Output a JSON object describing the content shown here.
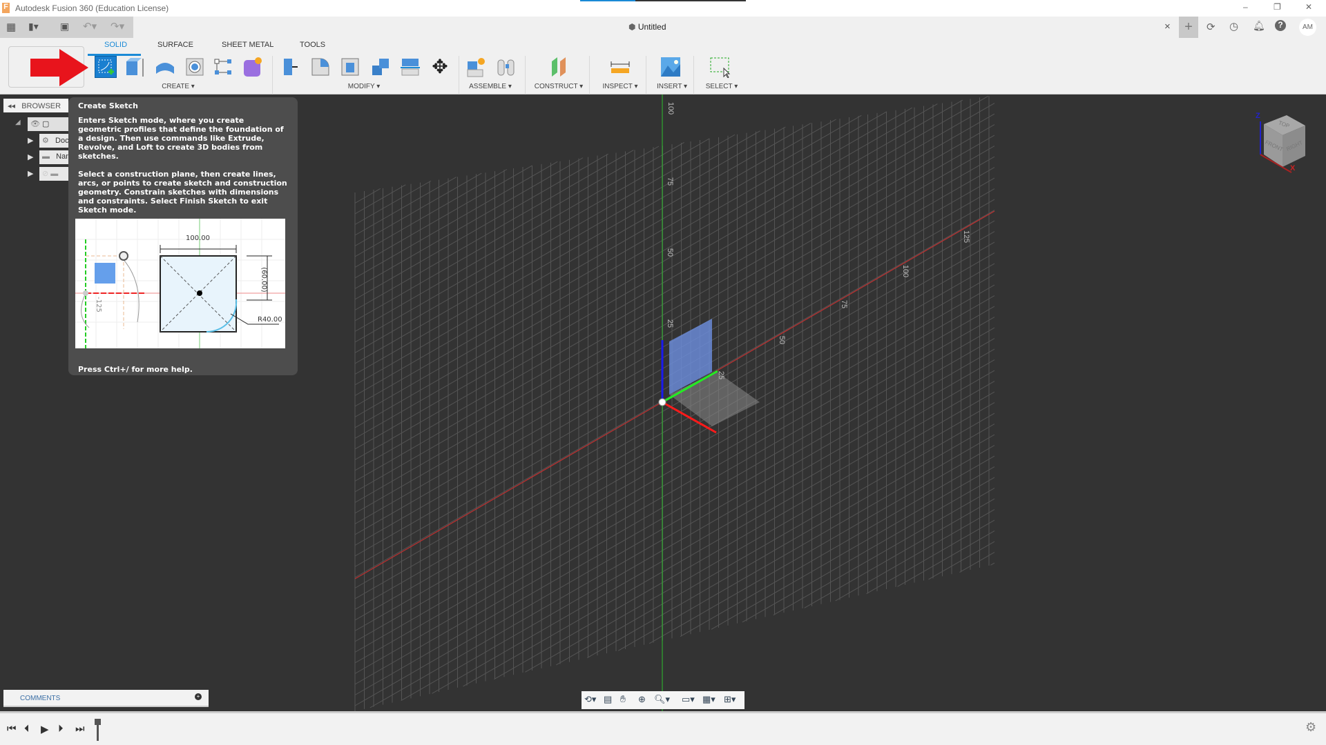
{
  "window": {
    "title": "Autodesk Fusion 360 (Education License)",
    "minimize": "–",
    "restore": "❐",
    "close": "✕"
  },
  "doc_tab": {
    "title": "Untitled",
    "close": "×",
    "user_initials": "AM"
  },
  "ribbon": {
    "tabs": [
      "SOLID",
      "SURFACE",
      "SHEET METAL",
      "TOOLS"
    ],
    "active_tab": "SOLID",
    "groups": {
      "create": "CREATE ▾",
      "modify": "MODIFY ▾",
      "assemble": "ASSEMBLE ▾",
      "construct": "CONSTRUCT ▾",
      "inspect": "INSPECT ▾",
      "insert": "INSERT ▾",
      "select": "SELECT ▾"
    }
  },
  "browser": {
    "title": "BROWSER",
    "items": [
      "",
      "Document Settings",
      "Named Views",
      ""
    ]
  },
  "tooltip": {
    "title": "Create Sketch",
    "p1": "Enters Sketch mode, where you create geometric profiles that define the foundation of a design. Then use commands like Extrude, Revolve, and Loft to create 3D bodies from sketches.",
    "p2": "Select a construction plane, then create lines, arcs, or points to create sketch and construction geometry. Constrain sketches with dimensions and constraints. Select Finish Sketch to exit Sketch mode.",
    "footer": "Press Ctrl+/ for more help.",
    "illustration": {
      "dim_width": "100.00",
      "dim_height": "(60.00)",
      "radius": "R40.00",
      "dim_neg": "-125"
    }
  },
  "viewcube": {
    "top": "TOP",
    "front": "FRONT",
    "right": "RIGHT",
    "z": "Z",
    "x": "X"
  },
  "axis_labels": {
    "vertical": [
      "100",
      "75",
      "50",
      "25"
    ],
    "horizontal": [
      "25",
      "50",
      "75",
      "100",
      "125"
    ]
  },
  "comments": {
    "label": "COMMENTS"
  },
  "colors": {
    "accent": "#1a8ad6",
    "x_axis": "#e02020",
    "y_axis": "#22cc22",
    "z_axis": "#1a1aee",
    "arrow": "#e8141c"
  }
}
